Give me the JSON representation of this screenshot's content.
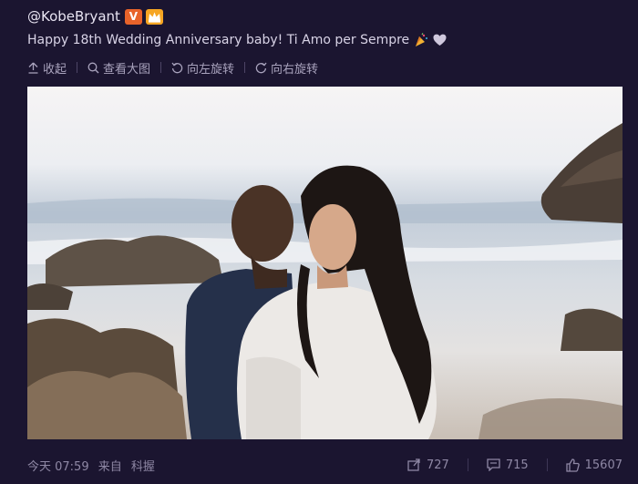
{
  "header": {
    "username": "@KobeBryant",
    "verified_badge": "V"
  },
  "post": {
    "text": "Happy 18th Wedding Anniversary baby! Ti Amo per Sempre",
    "emojis": [
      "party-popper-icon",
      "heart-icon"
    ]
  },
  "toolbar": {
    "collapse": "收起",
    "view_large": "查看大图",
    "rotate_left": "向左旋转",
    "rotate_right": "向右旋转"
  },
  "footer": {
    "time": "今天 07:59",
    "source_prefix": "来自",
    "source": "科握",
    "reposts": "727",
    "comments": "715",
    "likes": "15607"
  },
  "colors": {
    "background": "#1b1530",
    "verified": "#e8632a",
    "text": "#d8d3e6",
    "muted": "#a9a3bd"
  }
}
